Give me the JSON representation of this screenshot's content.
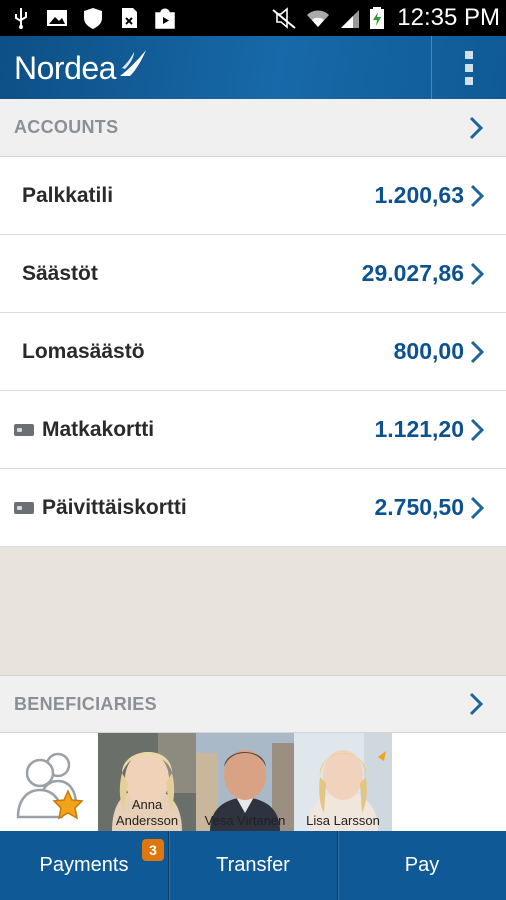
{
  "status_bar": {
    "time": "12:35 PM",
    "left_icons": [
      "usb-icon",
      "image-icon",
      "shield-icon",
      "sim-icon",
      "play-store-icon"
    ],
    "right_icons": [
      "mute-icon",
      "wifi-icon",
      "signal-icon",
      "battery-charging-icon"
    ]
  },
  "header": {
    "brand": "Nordea",
    "menu_icon": "overflow-menu-icon"
  },
  "accounts_section": {
    "title": "ACCOUNTS",
    "items": [
      {
        "name": "Palkkatili",
        "amount": "1.200,63",
        "card": false
      },
      {
        "name": "Säästöt",
        "amount": "29.027,86",
        "card": false
      },
      {
        "name": "Lomasäästö",
        "amount": "800,00",
        "card": false
      },
      {
        "name": "Matkakortti",
        "amount": "1.121,20",
        "card": true
      },
      {
        "name": "Päivittäiskortti",
        "amount": "2.750,50",
        "card": true
      }
    ]
  },
  "beneficiaries_section": {
    "title": "BENEFICIARIES",
    "people": [
      {
        "name_line1": "Anna",
        "name_line2": "Andersson"
      },
      {
        "name_line1": "Vesa Virtanen",
        "name_line2": ""
      },
      {
        "name_line1": "Lisa Larsson",
        "name_line2": ""
      }
    ]
  },
  "bottom_nav": {
    "payments": "Payments",
    "payments_badge": "3",
    "transfer": "Transfer",
    "pay": "Pay"
  },
  "colors": {
    "brand_blue": "#0f5a96",
    "amount_blue": "#0c5290",
    "badge_orange": "#e0760e"
  }
}
